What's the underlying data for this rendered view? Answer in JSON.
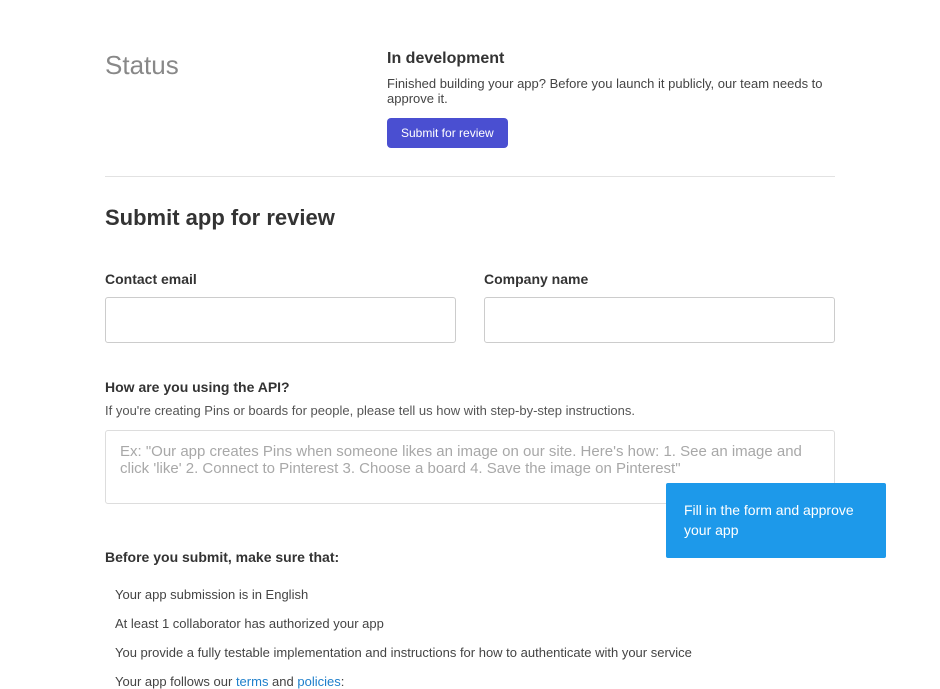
{
  "status": {
    "label": "Status",
    "title": "In development",
    "description": "Finished building your app? Before you launch it publicly, our team needs to approve it.",
    "button": "Submit for review"
  },
  "form": {
    "heading": "Submit app for review",
    "contact_email_label": "Contact email",
    "company_name_label": "Company name",
    "api_question_label": "How are you using the API?",
    "api_question_desc": "If you're creating Pins or boards for people, please tell us how with step-by-step instructions.",
    "api_placeholder": "Ex: \"Our app creates Pins when someone likes an image on our site. Here's how: 1. See an image and click 'like' 2. Connect to Pinterest 3. Choose a board 4. Save the image on Pinterest\""
  },
  "checklist": {
    "heading": "Before you submit, make sure that:",
    "items": [
      "Your app submission is in English",
      "At least 1 collaborator has authorized your app",
      "You provide a fully testable implementation and instructions for how to authenticate with your service"
    ],
    "last_prefix": "Your app follows our ",
    "terms": "terms",
    "and": " and ",
    "policies": "policies",
    "colon": ":"
  },
  "tooltip": {
    "text": "Fill in the form and approve your app"
  }
}
